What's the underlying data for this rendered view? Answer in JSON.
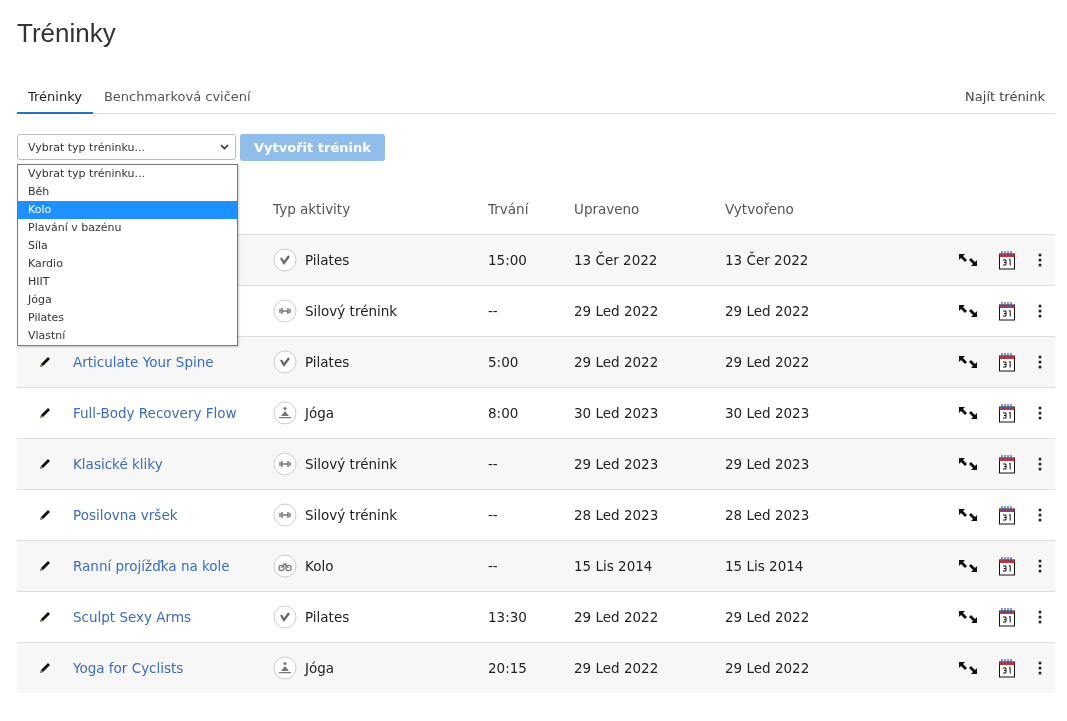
{
  "title": "Tréninky",
  "tabs": [
    {
      "label": "Tréninky",
      "selected": true
    },
    {
      "label": "Benchmarková cvičení",
      "selected": false
    }
  ],
  "find_link": "Najít trénink",
  "select": {
    "placeholder": "Vybrat typ tréninku...",
    "expanded": true,
    "options": [
      {
        "label": "Vybrat typ tréninku...",
        "selected": false
      },
      {
        "label": "Běh",
        "selected": false
      },
      {
        "label": "Kolo",
        "selected": true
      },
      {
        "label": "Plavání v bazénu",
        "selected": false
      },
      {
        "label": "Síla",
        "selected": false
      },
      {
        "label": "Kardio",
        "selected": false
      },
      {
        "label": "HIIT",
        "selected": false
      },
      {
        "label": "Jóga",
        "selected": false
      },
      {
        "label": "Pilates",
        "selected": false
      },
      {
        "label": "Vlastní",
        "selected": false
      }
    ]
  },
  "create_button": {
    "label": "Vytvořit trénink",
    "disabled": true
  },
  "table": {
    "columns": [
      "Typ aktivity",
      "Trvání",
      "Upraveno",
      "Vytvořeno"
    ],
    "rows": [
      {
        "kind": "pilates",
        "activity": "Pilates",
        "duration": "15:00",
        "modified": "13 Čer 2022",
        "created": "13 Čer 2022"
      },
      {
        "kind": "strength",
        "activity": "Silový trénink",
        "duration": "--",
        "modified": "29 Led 2022",
        "created": "29 Led 2022"
      },
      {
        "name": "Articulate Your Spine",
        "kind": "pilates",
        "activity": "Pilates",
        "duration": "5:00",
        "modified": "29 Led 2022",
        "created": "29 Led 2022"
      },
      {
        "name": "Full-Body Recovery Flow",
        "kind": "yoga",
        "activity": "Jóga",
        "duration": "8:00",
        "modified": "30 Led 2023",
        "created": "30 Led 2023"
      },
      {
        "name": "Klasické kliky",
        "kind": "strength",
        "activity": "Silový trénink",
        "duration": "--",
        "modified": "29 Led 2023",
        "created": "29 Led 2023"
      },
      {
        "name": "Posilovna vršek",
        "kind": "strength",
        "activity": "Silový trénink",
        "duration": "--",
        "modified": "28 Led 2023",
        "created": "28 Led 2023"
      },
      {
        "name": "Ranní projížďka na kole",
        "kind": "bike",
        "activity": "Kolo",
        "duration": "--",
        "modified": "15 Lis 2014",
        "created": "15 Lis 2014"
      },
      {
        "name": "Sculpt Sexy Arms",
        "kind": "pilates",
        "activity": "Pilates",
        "duration": "13:30",
        "modified": "29 Led 2022",
        "created": "29 Led 2022"
      },
      {
        "name": "Yoga for Cyclists",
        "kind": "yoga",
        "activity": "Jóga",
        "duration": "20:15",
        "modified": "29 Led 2022",
        "created": "29 Led 2022"
      }
    ]
  }
}
